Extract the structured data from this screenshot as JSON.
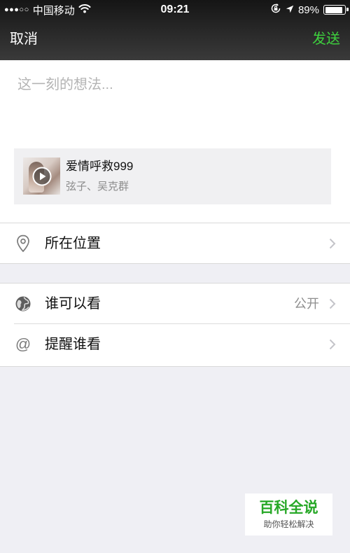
{
  "status_bar": {
    "signal": "●●●○○",
    "carrier": "中国移动",
    "time": "09:21",
    "battery_percent": "89%",
    "battery_level": 0.89
  },
  "nav": {
    "cancel_label": "取消",
    "send_label": "发送"
  },
  "compose": {
    "placeholder": "这一刻的想法..."
  },
  "music_card": {
    "title": "爱情呼救999",
    "artist": "弦子、吴克群"
  },
  "rows": {
    "location": {
      "label": "所在位置"
    },
    "visibility": {
      "label": "谁可以看",
      "value": "公开"
    },
    "mention": {
      "label": "提醒谁看",
      "glyph": "@"
    }
  },
  "watermark": {
    "title": "百科全说",
    "subtitle": "助你轻松解决"
  },
  "icons": {
    "wifi": "wifi-icon",
    "orientation_lock": "orientation-lock-icon",
    "location_services": "location-arrow-icon",
    "battery": "battery-icon",
    "play": "play-icon",
    "location": "location-pin-icon",
    "visibility": "globe-icon",
    "mention": "at-icon",
    "chevron": "chevron-right-icon"
  },
  "colors": {
    "header": "#2a2a2a",
    "send": "#3ed13e",
    "page_background": "#efeff4",
    "card_background": "#f0f0f2",
    "watermark_title": "#27a827"
  }
}
